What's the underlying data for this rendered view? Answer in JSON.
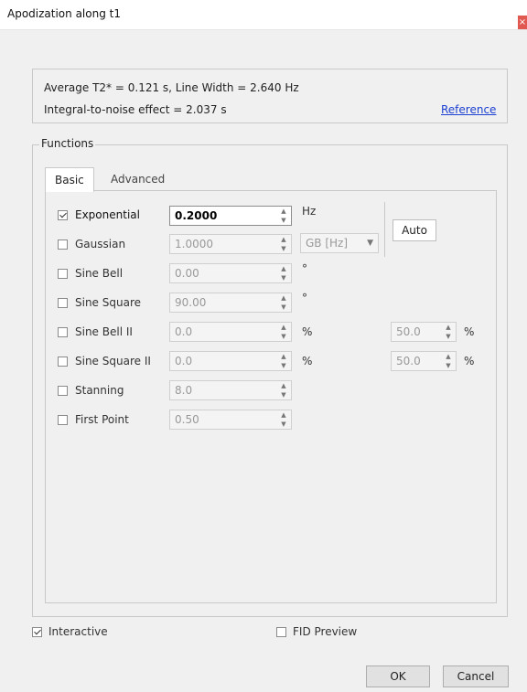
{
  "window": {
    "title": "Apodization along t1",
    "close_icon": "close-icon"
  },
  "info": {
    "line1": "Average T2* = 0.121 s, Line Width = 2.640 Hz",
    "line2": "Integral-to-noise effect = 2.037 s",
    "reference_link": "Reference"
  },
  "functions_group": {
    "label": "Functions"
  },
  "tabs": [
    {
      "label": "Basic",
      "active": true
    },
    {
      "label": "Advanced",
      "active": false
    }
  ],
  "rows": [
    {
      "label": "Exponential",
      "checked": true,
      "value": "0.2000",
      "unit": "Hz"
    },
    {
      "label": "Gaussian",
      "checked": false,
      "value": "1.0000",
      "select": "GB [Hz]"
    },
    {
      "label": "Sine Bell",
      "checked": false,
      "value": "0.00",
      "unit": "°"
    },
    {
      "label": "Sine Square",
      "checked": false,
      "value": "90.00",
      "unit": "°"
    },
    {
      "label": "Sine Bell II",
      "checked": false,
      "value": "0.0",
      "unit": "%",
      "value2": "50.0",
      "unit2": "%"
    },
    {
      "label": "Sine Square II",
      "checked": false,
      "value": "0.0",
      "unit": "%",
      "value2": "50.0",
      "unit2": "%"
    },
    {
      "label": "Stanning",
      "checked": false,
      "value": "8.0"
    },
    {
      "label": "First Point",
      "checked": false,
      "value": "0.50"
    }
  ],
  "auto_button": "Auto",
  "interactive": {
    "label": "Interactive",
    "checked": true
  },
  "fid_preview": {
    "label": "FID Preview",
    "checked": false
  },
  "buttons": {
    "ok": "OK",
    "cancel": "Cancel"
  },
  "colors": {
    "link": "#1a3fd1",
    "close": "#e0584f",
    "background": "#f0f0f0"
  }
}
